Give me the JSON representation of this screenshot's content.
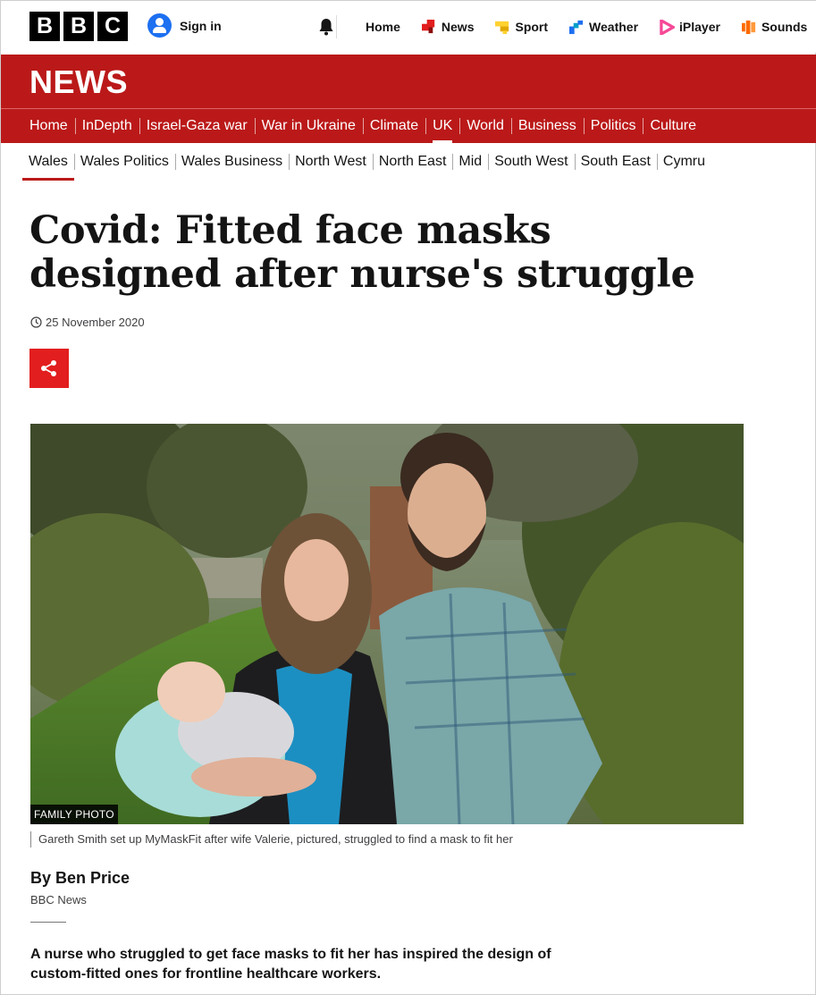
{
  "header": {
    "logo_letters": [
      "B",
      "B",
      "C"
    ],
    "sign_in_label": "Sign in",
    "nav": [
      {
        "label": "Home",
        "icon": "none",
        "color": ""
      },
      {
        "label": "News",
        "icon": "news-icon",
        "color": "#e21e1e"
      },
      {
        "label": "Sport",
        "icon": "sport-icon",
        "color": "#ffd230"
      },
      {
        "label": "Weather",
        "icon": "weather-icon",
        "color": "#1d70f0"
      },
      {
        "label": "iPlayer",
        "icon": "iplayer-icon",
        "color": "#f54997"
      },
      {
        "label": "Sounds",
        "icon": "sounds-icon",
        "color": "#ff6a00"
      }
    ]
  },
  "news_banner": {
    "title": "NEWS",
    "color": "#bb1919"
  },
  "section_nav": {
    "items": [
      "Home",
      "InDepth",
      "Israel-Gaza war",
      "War in Ukraine",
      "Climate",
      "UK",
      "World",
      "Business",
      "Politics",
      "Culture"
    ],
    "active": "UK"
  },
  "sub_nav": {
    "items": [
      "Wales",
      "Wales Politics",
      "Wales Business",
      "North West",
      "North East",
      "Mid",
      "South West",
      "South East",
      "Cymru"
    ],
    "active": "Wales"
  },
  "article": {
    "headline": "Covid: Fitted face masks designed after nurse's struggle",
    "date": "25 November 2020",
    "image_credit": "FAMILY PHOTO",
    "image_caption": "Gareth Smith set up MyMaskFit after wife Valerie, pictured, struggled to find a mask to fit her",
    "author": "By Ben Price",
    "author_org": "BBC News",
    "lede": "A nurse who struggled to get face masks to fit her has inspired the design of custom-fitted ones for frontline healthcare workers."
  }
}
